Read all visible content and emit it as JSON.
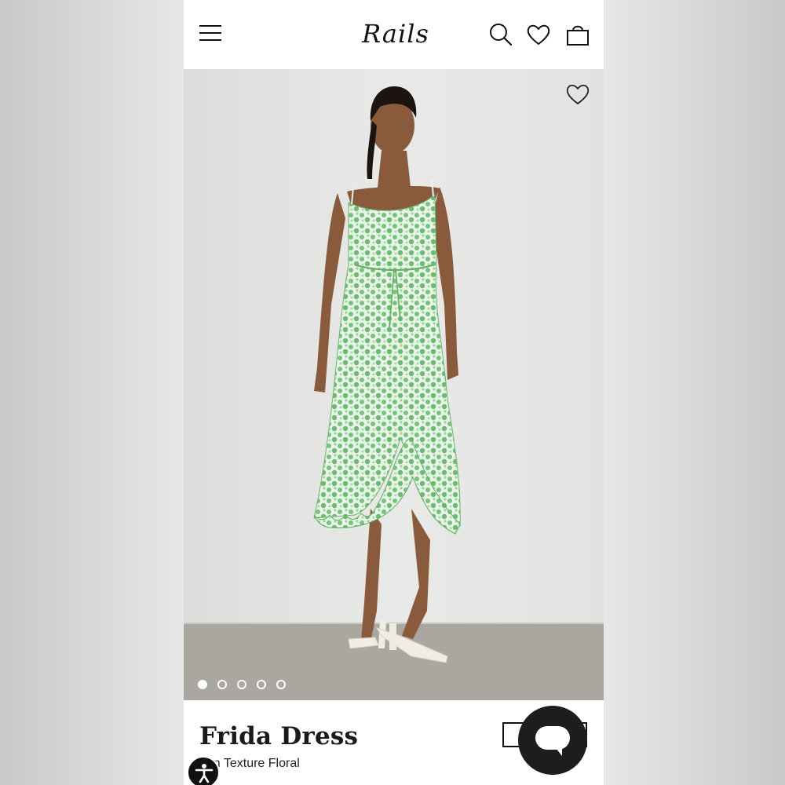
{
  "header": {
    "brand": "Rails",
    "menu_icon": "hamburger-menu-icon",
    "search_icon": "search-icon",
    "wishlist_icon": "heart-icon",
    "bag_icon": "shopping-bag-icon"
  },
  "gallery": {
    "wishlist_icon": "heart-outline-icon",
    "current_slide": 1,
    "slide_count": 5
  },
  "product": {
    "name": "Frida Dress",
    "color": "een Texture Floral"
  },
  "widgets": {
    "chat_icon": "chat-bubble-icon",
    "accessibility_icon": "accessibility-icon"
  },
  "colors": {
    "text": "#1a1a1a",
    "accent_dress": "#7cc47f",
    "background": "#ffffff"
  }
}
